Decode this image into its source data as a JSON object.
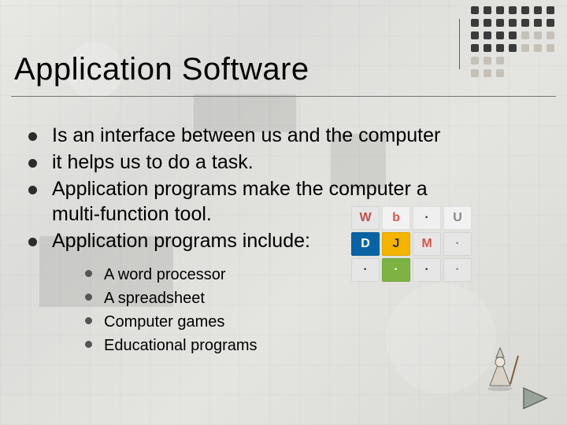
{
  "title": "Application Software",
  "bullets": [
    "Is an interface between us and the computer",
    "it helps us to do a task.",
    "Application programs make the computer a multi-function tool.",
    "Application programs include:"
  ],
  "sub_bullets": [
    "A word processor",
    "A spreadsheet",
    "Computer games",
    "Educational programs"
  ],
  "app_icons": [
    "W",
    "b",
    "·",
    "U",
    "D",
    "J",
    "M",
    "·",
    "·",
    "·",
    "·",
    "·"
  ],
  "nav": {
    "next": "Next slide"
  }
}
